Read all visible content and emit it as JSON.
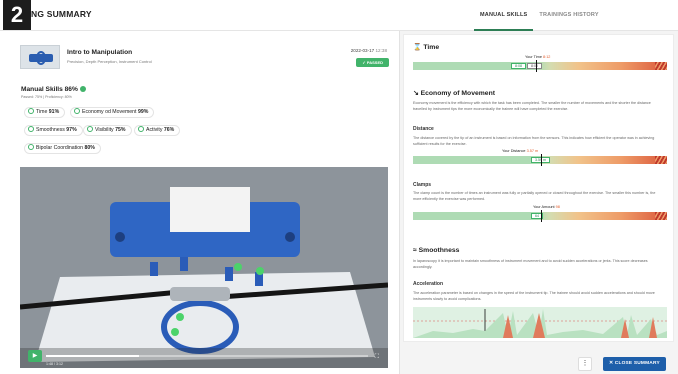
{
  "header": {
    "badge": "2",
    "title": "NG SUMMARY",
    "tabs": [
      "MANUAL SKILLS",
      "TRAININGS HISTORY"
    ]
  },
  "training": {
    "title": "Intro to Manipulation",
    "subtitle": "Precision, Depth Perception, Instrument Control",
    "date": "2022-03-17",
    "time": "12:38",
    "status": "PASSED"
  },
  "manual_skills": {
    "title": "Manual Skills 86%",
    "subtitle": "Passed: 75% | Proficiency: 80%",
    "chips": [
      {
        "label": "Time",
        "value": "91%"
      },
      {
        "label": "Economy od Movement",
        "value": "99%"
      },
      {
        "label": "Smoothness",
        "value": "97%"
      },
      {
        "label": "Visibility",
        "value": "75%"
      },
      {
        "label": "Activity",
        "value": "76%"
      },
      {
        "label": "Bipolar Coordination",
        "value": "80%"
      }
    ]
  },
  "video": {
    "time": "1:48 / 3:12",
    "progress": 0.29
  },
  "panel": {
    "time": {
      "title": "Time",
      "marker_label": "Your Time",
      "marker_value": "8:12",
      "left_value": "8:08",
      "right_value": "8:00"
    },
    "economy": {
      "title": "Economy of Movement",
      "desc": "Economy movement is the efficiency with which the task has been completed. The smaller the number of movements and the shorter the distance travelled by instrument tips the more economically the trainee will have completed the exercise."
    },
    "distance": {
      "title": "Distance",
      "desc": "The distance covered by the tip of an instrument is based on information from the sensors. This indicates how efficient the operator was in achieving sufficient results for the exercise.",
      "marker_label": "Your Distance",
      "marker_value": "3.57 m",
      "bar_value": "3.59 m"
    },
    "clamps": {
      "title": "Clamps",
      "desc": "The clamp count is the number of times an instrument was fully or partially opened or closed throughout the exercise. The smaller this number is, the more efficiently the exercise was performed.",
      "marker_label": "Your Amount",
      "marker_value": "98",
      "bar_value": "64"
    },
    "smoothness": {
      "title": "Smoothness",
      "desc": "In laparoscopy it is important to maintain smoothness of instrument movement and to avoid sudden accelerations or jerks. This score decreases accordingly."
    },
    "acceleration": {
      "title": "Acceleration",
      "desc": "The acceleration parameter is based on changes in the speed of the instrument tip. The trainee should avoid sudden accelerations and should move instruments slowly to avoid complications."
    }
  },
  "footer": {
    "menu": "⋮",
    "close": "CLOSE SUMMARY"
  },
  "colors": {
    "accent": "#41b36a",
    "primary": "#1e5faa"
  }
}
